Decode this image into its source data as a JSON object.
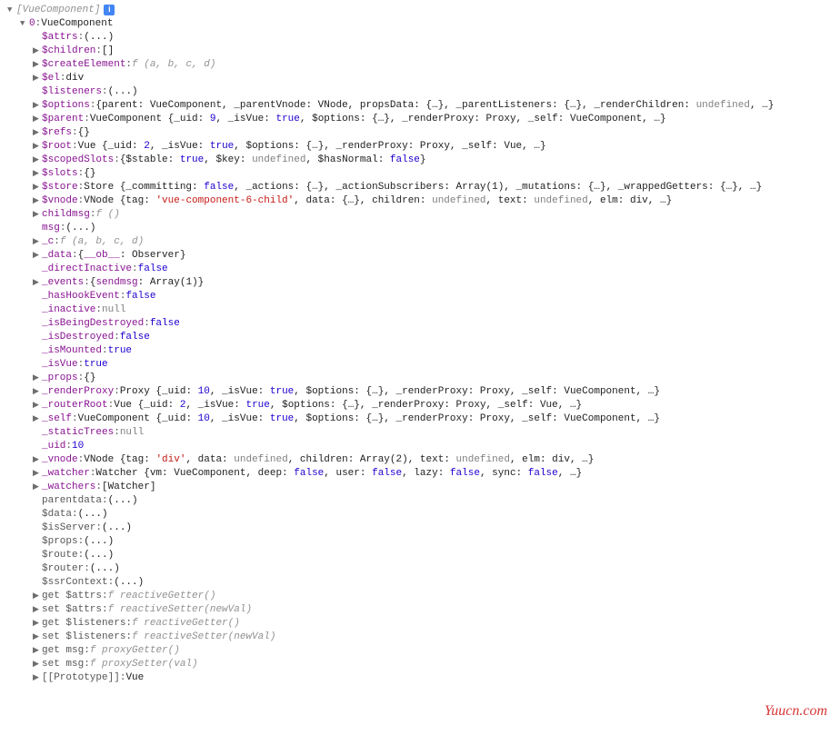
{
  "root": {
    "label": "[VueComponent]",
    "info": true
  },
  "index0": {
    "key": "0",
    "val": "VueComponent"
  },
  "lines": [
    {
      "arrow": false,
      "key": "$attrs",
      "colon": ": ",
      "val": "(...)",
      "valClass": "summary"
    },
    {
      "arrow": true,
      "key": "$children",
      "colon": ": ",
      "val": "[]",
      "valClass": "summary"
    },
    {
      "arrow": true,
      "key": "$createElement",
      "colon": ": ",
      "val": "f (a, b, c, d)",
      "valClass": "dim",
      "italic": true
    },
    {
      "arrow": true,
      "key": "$el",
      "colon": ": ",
      "val": "div",
      "valClass": "summary"
    },
    {
      "arrow": false,
      "key": "$listeners",
      "colon": ": ",
      "val": "(...)",
      "valClass": "summary"
    },
    {
      "arrow": true,
      "key": "$options",
      "colon": ": ",
      "html": "{parent: VueComponent, _parentVnode: VNode, propsData: <span class='obj'>{…}</span>, _parentListeners: <span class='obj'>{…}</span>, _renderChildren: <span class='undef'>undefined</span>, …}"
    },
    {
      "arrow": true,
      "key": "$parent",
      "colon": ": ",
      "html": "VueComponent {_uid: <span class='num'>9</span>, _isVue: <span class='bool'>true</span>, $options: <span class='obj'>{…}</span>, _renderProxy: Proxy, _self: VueComponent, …}"
    },
    {
      "arrow": true,
      "key": "$refs",
      "colon": ": ",
      "val": "{}",
      "valClass": "summary"
    },
    {
      "arrow": true,
      "key": "$root",
      "colon": ": ",
      "html": "Vue {_uid: <span class='num'>2</span>, _isVue: <span class='bool'>true</span>, $options: <span class='obj'>{…}</span>, _renderProxy: Proxy, _self: Vue, …}"
    },
    {
      "arrow": true,
      "key": "$scopedSlots",
      "colon": ": ",
      "html": "{$stable: <span class='bool'>true</span>, $key: <span class='undef'>undefined</span>, $hasNormal: <span class='bool'>false</span>}"
    },
    {
      "arrow": true,
      "key": "$slots",
      "colon": ": ",
      "val": "{}",
      "valClass": "summary"
    },
    {
      "arrow": true,
      "key": "$store",
      "colon": ": ",
      "html": "Store {_committing: <span class='bool'>false</span>, _actions: <span class='obj'>{…}</span>, _actionSubscribers: Array(1), _mutations: <span class='obj'>{…}</span>, _wrappedGetters: <span class='obj'>{…}</span>, …}"
    },
    {
      "arrow": true,
      "key": "$vnode",
      "colon": ": ",
      "html": "VNode {tag: <span class='str'>'vue-component-6-child'</span>, data: <span class='obj'>{…}</span>, children: <span class='undef'>undefined</span>, text: <span class='undef'>undefined</span>, elm: div, …}"
    },
    {
      "arrow": true,
      "key": "childmsg",
      "colon": ": ",
      "val": "f ()",
      "valClass": "dim",
      "italic": true
    },
    {
      "arrow": false,
      "key": "msg",
      "colon": ": ",
      "val": "(...)",
      "valClass": "summary"
    },
    {
      "arrow": true,
      "key": "_c",
      "colon": ": ",
      "val": "f (a, b, c, d)",
      "valClass": "dim",
      "italic": true
    },
    {
      "arrow": true,
      "key": "_data",
      "colon": ": ",
      "html": "{<span class='key-purple'>__ob__</span>: Observer}",
      "keyClass": "key-purple"
    },
    {
      "arrow": false,
      "key": "_directInactive",
      "colon": ": ",
      "val": "false",
      "valClass": "bool",
      "keyClass": "key-purple"
    },
    {
      "arrow": true,
      "key": "_events",
      "colon": ": ",
      "html": "{<span class='key-purple'>sendmsg</span>: Array(1)}",
      "keyClass": "key-purple"
    },
    {
      "arrow": false,
      "key": "_hasHookEvent",
      "colon": ": ",
      "val": "false",
      "valClass": "bool",
      "keyClass": "key-purple"
    },
    {
      "arrow": false,
      "key": "_inactive",
      "colon": ": ",
      "val": "null",
      "valClass": "undef",
      "keyClass": "key-purple"
    },
    {
      "arrow": false,
      "key": "_isBeingDestroyed",
      "colon": ": ",
      "val": "false",
      "valClass": "bool",
      "keyClass": "key-purple"
    },
    {
      "arrow": false,
      "key": "_isDestroyed",
      "colon": ": ",
      "val": "false",
      "valClass": "bool",
      "keyClass": "key-purple"
    },
    {
      "arrow": false,
      "key": "_isMounted",
      "colon": ": ",
      "val": "true",
      "valClass": "bool",
      "keyClass": "key-purple"
    },
    {
      "arrow": false,
      "key": "_isVue",
      "colon": ": ",
      "val": "true",
      "valClass": "bool",
      "keyClass": "key-purple"
    },
    {
      "arrow": true,
      "key": "_props",
      "colon": ": ",
      "val": "{}",
      "valClass": "summary",
      "keyClass": "key-purple"
    },
    {
      "arrow": true,
      "key": "_renderProxy",
      "colon": ": ",
      "html": "Proxy {_uid: <span class='num'>10</span>, _isVue: <span class='bool'>true</span>, $options: <span class='obj'>{…}</span>, _renderProxy: Proxy, _self: VueComponent, …}",
      "keyClass": "key-purple"
    },
    {
      "arrow": true,
      "key": "_routerRoot",
      "colon": ": ",
      "html": "Vue {_uid: <span class='num'>2</span>, _isVue: <span class='bool'>true</span>, $options: <span class='obj'>{…}</span>, _renderProxy: Proxy, _self: Vue, …}",
      "keyClass": "key-purple"
    },
    {
      "arrow": true,
      "key": "_self",
      "colon": ": ",
      "html": "VueComponent {_uid: <span class='num'>10</span>, _isVue: <span class='bool'>true</span>, $options: <span class='obj'>{…}</span>, _renderProxy: Proxy, _self: VueComponent, …}",
      "keyClass": "key-purple"
    },
    {
      "arrow": false,
      "key": "_staticTrees",
      "colon": ": ",
      "val": "null",
      "valClass": "undef",
      "keyClass": "key-purple"
    },
    {
      "arrow": false,
      "key": "_uid",
      "colon": ": ",
      "val": "10",
      "valClass": "num",
      "keyClass": "key-purple"
    },
    {
      "arrow": true,
      "key": "_vnode",
      "colon": ": ",
      "html": "VNode {tag: <span class='str'>'div'</span>, data: <span class='undef'>undefined</span>, children: Array(2), text: <span class='undef'>undefined</span>, elm: div, …}",
      "keyClass": "key-purple"
    },
    {
      "arrow": true,
      "key": "_watcher",
      "colon": ": ",
      "html": "Watcher {vm: VueComponent, deep: <span class='bool'>false</span>, user: <span class='bool'>false</span>, lazy: <span class='bool'>false</span>, sync: <span class='bool'>false</span>, …}",
      "keyClass": "key-purple"
    },
    {
      "arrow": true,
      "key": "_watchers",
      "colon": ": ",
      "val": "[Watcher]",
      "valClass": "summary",
      "keyClass": "key-purple"
    },
    {
      "arrow": false,
      "key": "parentdata",
      "colon": ": ",
      "val": "(...)",
      "valClass": "summary",
      "keyClass": "key-dark"
    },
    {
      "arrow": false,
      "key": "$data",
      "colon": ": ",
      "val": "(...)",
      "valClass": "summary",
      "keyClass": "key-dark"
    },
    {
      "arrow": false,
      "key": "$isServer",
      "colon": ": ",
      "val": "(...)",
      "valClass": "summary",
      "keyClass": "key-dark"
    },
    {
      "arrow": false,
      "key": "$props",
      "colon": ": ",
      "val": "(...)",
      "valClass": "summary",
      "keyClass": "key-dark"
    },
    {
      "arrow": false,
      "key": "$route",
      "colon": ": ",
      "val": "(...)",
      "valClass": "summary",
      "keyClass": "key-dark"
    },
    {
      "arrow": false,
      "key": "$router",
      "colon": ": ",
      "val": "(...)",
      "valClass": "summary",
      "keyClass": "key-dark"
    },
    {
      "arrow": false,
      "key": "$ssrContext",
      "colon": ": ",
      "val": "(...)",
      "valClass": "summary",
      "keyClass": "key-dark"
    },
    {
      "arrow": true,
      "key": "get $attrs",
      "colon": ": ",
      "val": "f reactiveGetter()",
      "valClass": "dim",
      "italic": true,
      "keyClass": "key-dark"
    },
    {
      "arrow": true,
      "key": "set $attrs",
      "colon": ": ",
      "val": "f reactiveSetter(newVal)",
      "valClass": "dim",
      "italic": true,
      "keyClass": "key-dark"
    },
    {
      "arrow": true,
      "key": "get $listeners",
      "colon": ": ",
      "val": "f reactiveGetter()",
      "valClass": "dim",
      "italic": true,
      "keyClass": "key-dark"
    },
    {
      "arrow": true,
      "key": "set $listeners",
      "colon": ": ",
      "val": "f reactiveSetter(newVal)",
      "valClass": "dim",
      "italic": true,
      "keyClass": "key-dark"
    },
    {
      "arrow": true,
      "key": "get msg",
      "colon": ": ",
      "val": "f proxyGetter()",
      "valClass": "dim",
      "italic": true,
      "keyClass": "key-dark"
    },
    {
      "arrow": true,
      "key": "set msg",
      "colon": ": ",
      "val": "f proxySetter(val)",
      "valClass": "dim",
      "italic": true,
      "keyClass": "key-dark"
    },
    {
      "arrow": true,
      "key": "[[Prototype]]",
      "colon": ": ",
      "val": "Vue",
      "valClass": "summary",
      "keyClass": "key-dark"
    }
  ],
  "watermark": "Yuucn.com"
}
